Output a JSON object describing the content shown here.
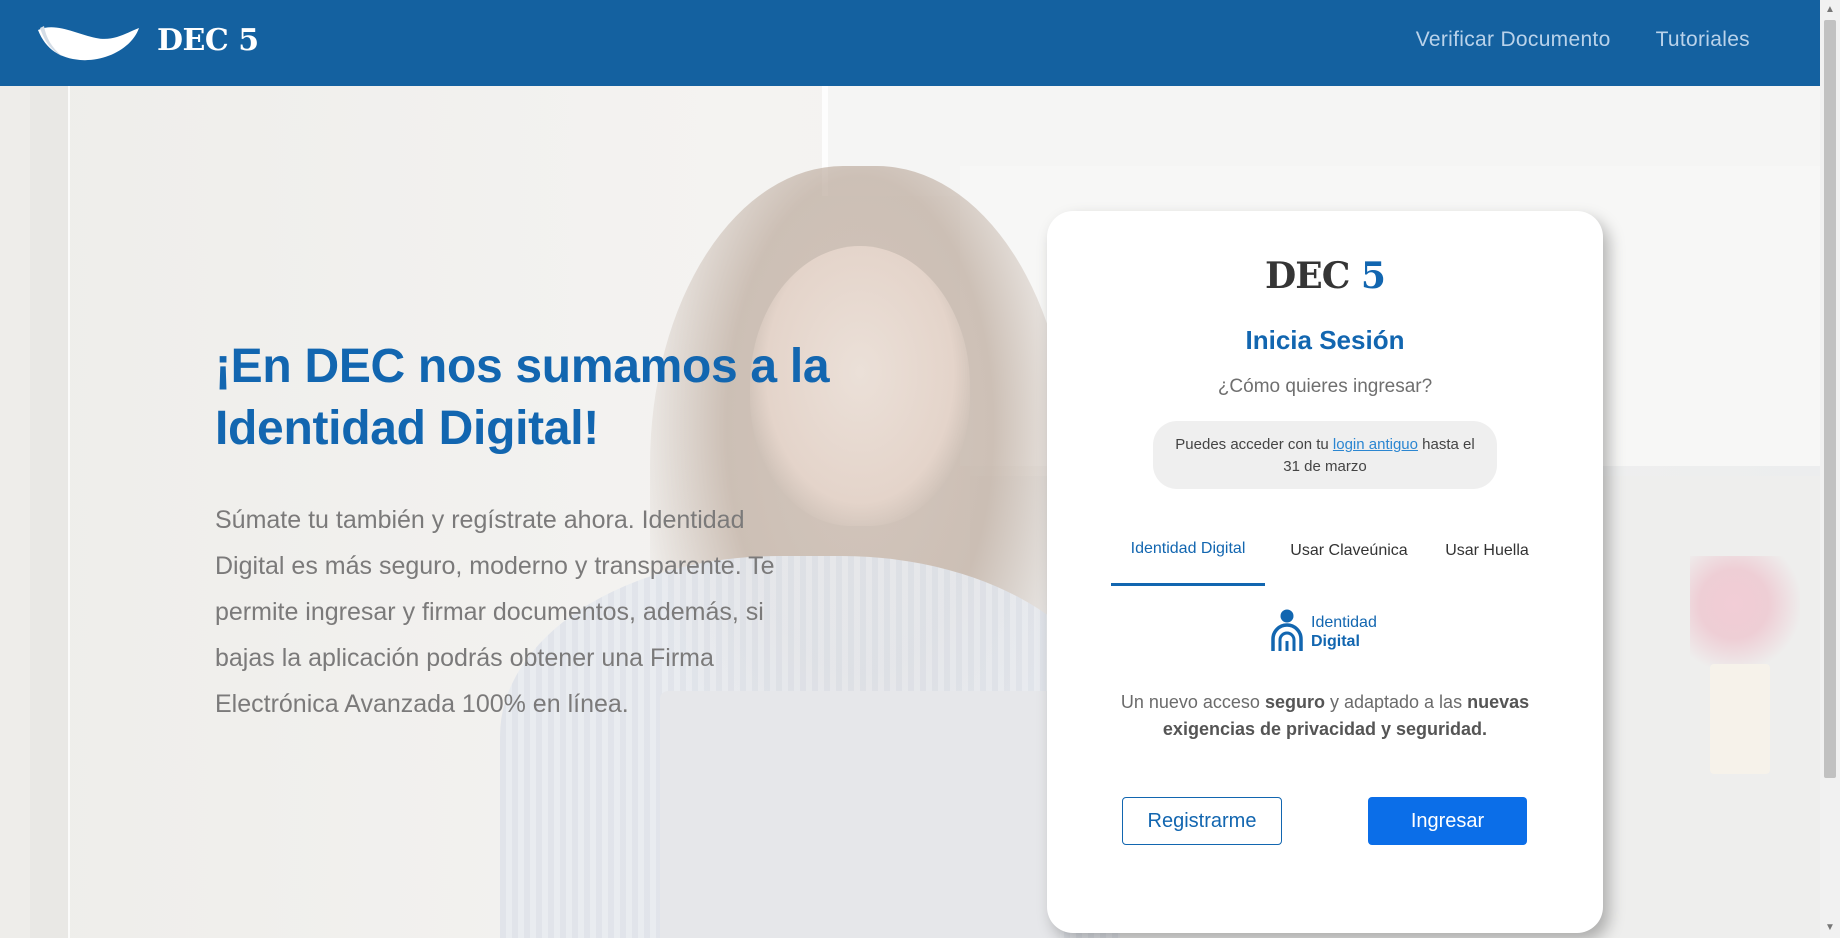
{
  "header": {
    "brand": "DEC 5",
    "nav": [
      "Verificar Documento",
      "Tutoriales"
    ],
    "bg_color": "#1461a0"
  },
  "hero": {
    "headline": "¡En DEC nos sumamos a la Identidad Digital!",
    "lead": "Súmate tu también y regístrate ahora. Identidad Digital es más seguro, moderno y transparente. Te permite ingresar y firmar documentos, además, si bajas la aplicación podrás obtener una Firma Electrónica Avanzada 100% en línea."
  },
  "card": {
    "brand_dec": "DEC",
    "brand_five": "5",
    "title": "Inicia Sesión",
    "subtitle": "¿Cómo quieres ingresar?",
    "notice": {
      "before": "Puedes acceder con tu ",
      "link": "login antiguo",
      "after": " hasta el 31 de marzo"
    },
    "tabs": [
      "Identidad Digital",
      "Usar Claveúnica",
      "Usar Huella"
    ],
    "active_tab": 0,
    "id_logo": {
      "line1": "Identidad",
      "line2": "Digital",
      "icon": "identity-person-fingerprint-icon"
    },
    "desc": {
      "p1": "Un nuevo acceso ",
      "b1": "seguro",
      "p2": " y adaptado a las ",
      "b2": "nuevas exigencias de privacidad y seguridad."
    },
    "register_label": "Registrarme",
    "login_label": "Ingresar",
    "accent": "#1266b0",
    "button_color": "#0b6ee8"
  }
}
